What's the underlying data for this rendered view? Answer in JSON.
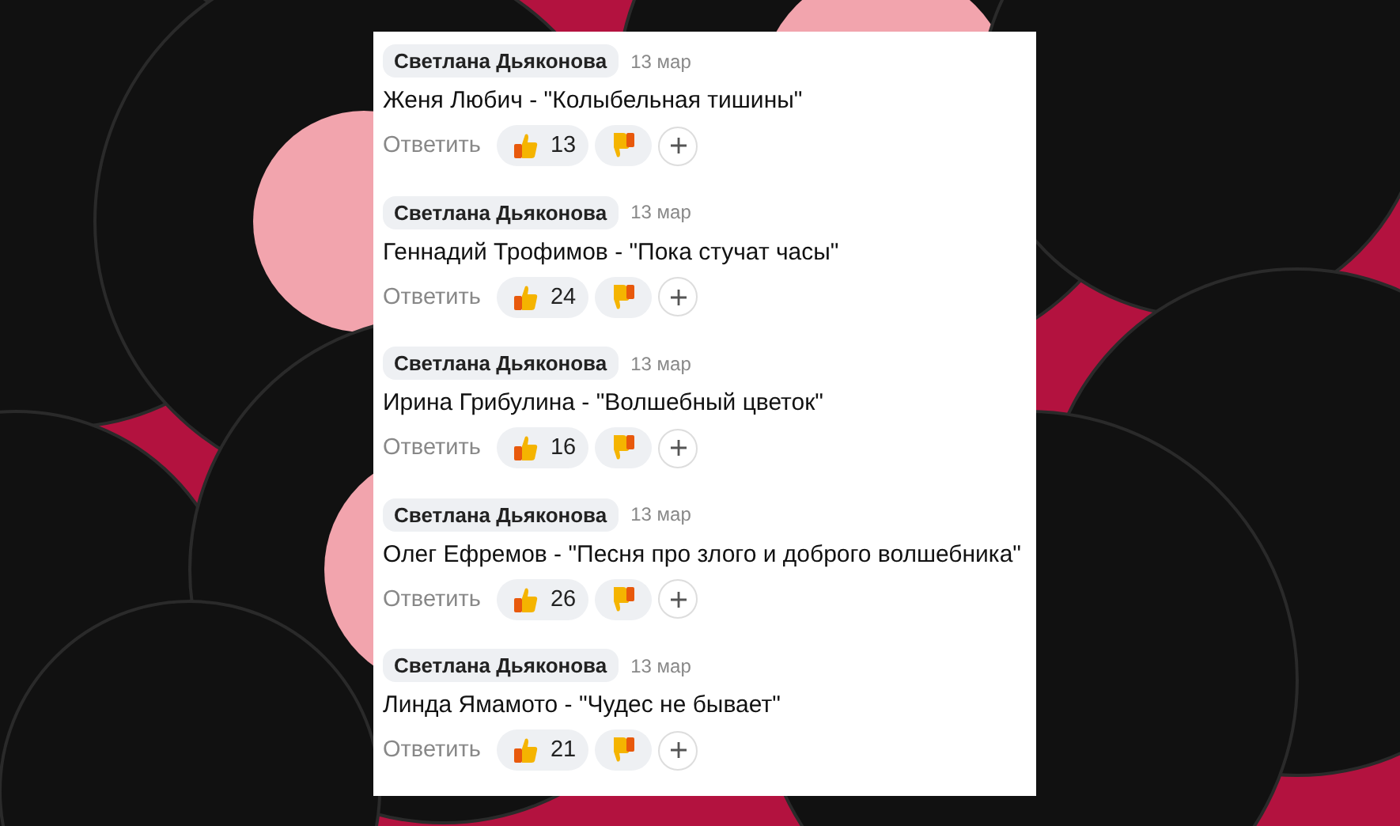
{
  "comments": [
    {
      "author": "Светлана Дьяконова",
      "date": "13 мар",
      "text": "Женя Любич - \"Колыбельная тишины\"",
      "reply_label": "Ответить",
      "likes": "13"
    },
    {
      "author": "Светлана Дьяконова",
      "date": "13 мар",
      "text": "Геннадий Трофимов - \"Пока стучат часы\"",
      "reply_label": "Ответить",
      "likes": "24"
    },
    {
      "author": "Светлана Дьяконова",
      "date": "13 мар",
      "text": "Ирина Грибулина - \"Волшебный цветок\"",
      "reply_label": "Ответить",
      "likes": "16"
    },
    {
      "author": "Светлана Дьяконова",
      "date": "13 мар",
      "text": "Олег Ефремов - \"Песня про злого и доброго волшебника\"",
      "reply_label": "Ответить",
      "likes": "26"
    },
    {
      "author": "Светлана Дьяконова",
      "date": "13 мар",
      "text": "Линда Ямамото - \"Чудес не бывает\"",
      "reply_label": "Ответить",
      "likes": "21"
    }
  ]
}
